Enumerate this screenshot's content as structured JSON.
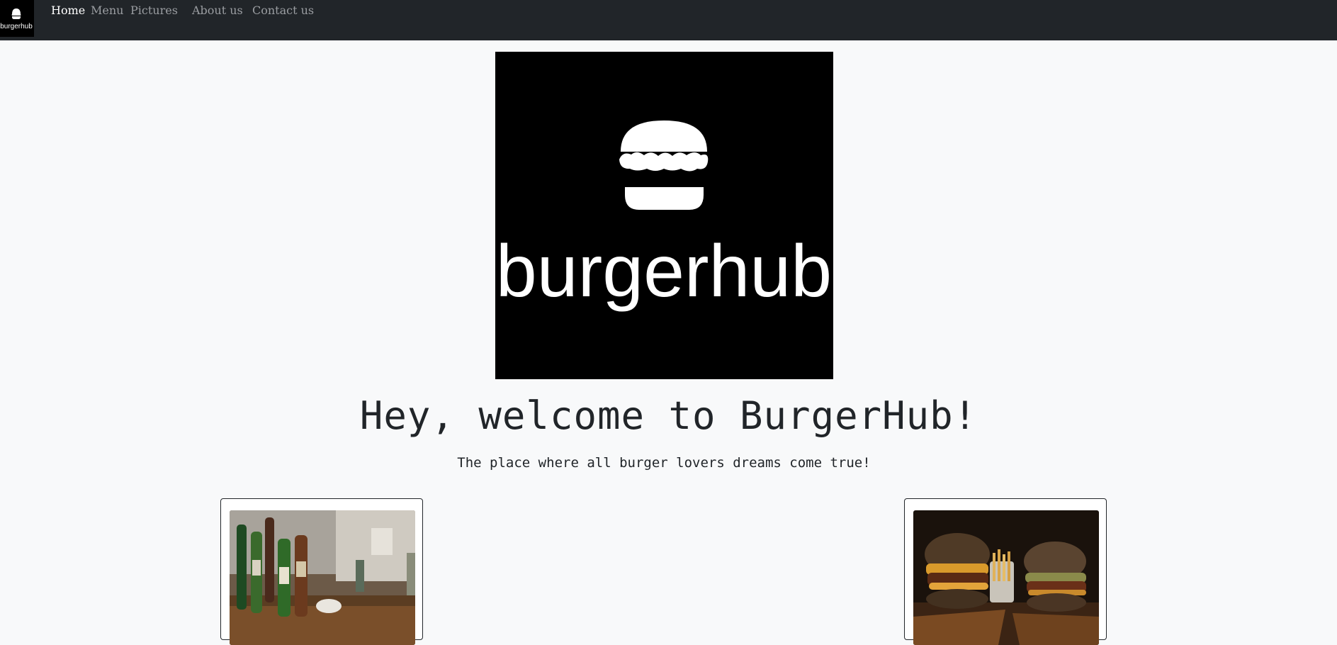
{
  "navbar": {
    "logo_text": "burgerhub",
    "links": [
      {
        "label": "Home",
        "active": true
      },
      {
        "label": "Menu",
        "active": false
      },
      {
        "label": "Pictures",
        "active": false
      },
      {
        "label": "About us",
        "active": false
      },
      {
        "label": "Contact us",
        "active": false
      }
    ]
  },
  "hero": {
    "logo_text": "burgerhub",
    "title": "Hey, welcome to BurgerHub!",
    "subtitle": "The place where all burger lovers dreams come true!"
  },
  "cards": [
    {
      "image": "beer-bottles-on-table-photo"
    },
    {
      "image": "burgers-and-fries-photo"
    }
  ],
  "colors": {
    "navbar_bg": "#212529",
    "page_bg": "#f8f9fa",
    "logo_bg": "#000000",
    "active_link": "#ffffff",
    "inactive_link": "#9a9da1"
  }
}
